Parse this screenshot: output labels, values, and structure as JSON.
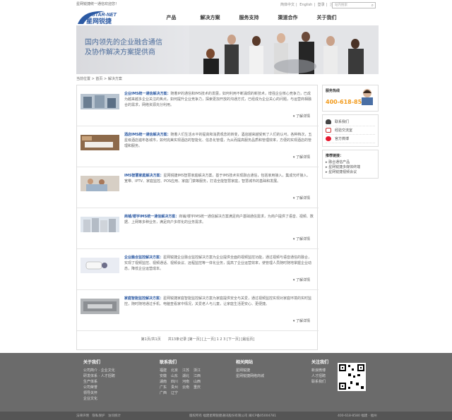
{
  "topbar": {
    "welcome": "星网锐捷统一通信欢迎您！",
    "links": [
      "简体中文",
      "|",
      "English",
      "|",
      "登录",
      "|",
      "注册",
      "|",
      "留言"
    ],
    "search_placeholder": "站内搜索"
  },
  "logo": {
    "en": "STAR-NET",
    "cn": "星网锐捷"
  },
  "nav": [
    "产品",
    "解决方案",
    "服务支持",
    "渠道合作",
    "关于我们"
  ],
  "banner": {
    "line1": "国内领先的企业融合通信",
    "line2": "及协作解决方案提供商"
  },
  "breadcrumb": {
    "prefix": "当前位置",
    "sep": ">",
    "home": "首页",
    "current": "解决方案"
  },
  "items": [
    {
      "title": "企业IMS统一通信解决方案：",
      "desc": "随着IP的通信和IMS技术的发展，如何利用不断涌现的新技术，增强企业核心竞争力，已成为越来越多企业关注的焦点，如何提升企业竞争力，探索更加开放的沟通方式，已经成为企业关心的问题，与运营商相融合的需求，网络资源充分利用。",
      "more": "了解详情"
    },
    {
      "title": "酒店IMS统一通信解决方案：",
      "desc": "随着人们生活水平的提高和消费观念的转变，酒店越来越受到了人们的认可，各种档次，五星级酒店遍布各城市，如何完美实现酒店的智能化、信息化管理，为从而提高服务品质和管理效率，方便的实现酒店的管理和服务。",
      "more": "了解详情"
    },
    {
      "title": "IMS智慧家庭解决方案：",
      "desc": "星网锐捷IMS智慧家庭解决方案，基于IMS技术实现融合通信，包括家用接入，集成光纤接入、宽带、IPTV、家庭监控、POS应用、家庭门禁等服务，打造全能智慧家庭，智慧城市的基础和发展。",
      "more": "了解详情"
    },
    {
      "title": "商铺/楼宇IMS统一通信解决方案：",
      "desc": "商铺/楼宇IMS统一通信解决方案满足商户基础通信需求，为商户提供了语音、视频、数据、上网等多种业务，满足商户多样化的业务需求。",
      "more": "了解详情"
    },
    {
      "title": "企业融合监控解决方案：",
      "desc": "星网锐捷企业融合监控解决方案为企业提供全面的视频监控功能，通过视频与语音通信的融合，实现了视频监控、视频通话、视频会议、远程监控等一体化业务，提高了企业运营效率，使管理人员随时随地掌握企业动态，降低企业运营成本。",
      "more": "了解详情"
    },
    {
      "title": "家庭智能监控解决方案：",
      "desc": "星网锐捷家庭智能监控解决方案为家庭提供安全与关爱，通过视频监控实现对家庭环境的实时监控，随时随地通过手机、电脑查看家中情况，关爱老人与儿童，让家庭生活更安心、更便捷。",
      "more": "了解详情"
    }
  ],
  "pager": "第1页/共1页　　共13条记录 [第一页] [上一页] 1 2 3 [下一页] [最后页]",
  "sidebar": {
    "hotline_label": "服务热线",
    "hotline_number": "400-618-8580",
    "menu": [
      "联系我们",
      "经验交流室",
      "官方微博"
    ],
    "links_title": "推荐链接：",
    "links": [
      "融合通信产品",
      "星网锐捷多媒体终端",
      "星网锐捷视频会议"
    ]
  },
  "footer": {
    "col1": {
      "title": "关于我们",
      "items": [
        "公司简介 · 企业文化",
        "研发体系 · 人才招聘",
        "生产体系",
        "公司荣誉",
        "领导关怀",
        "企业文化"
      ]
    },
    "col2": {
      "title": "联系我们",
      "items": [
        "福建",
        "北京",
        "江苏",
        "浙江",
        "安徽",
        "山东",
        "湖北",
        "江西",
        "湖南",
        "四川",
        "河南",
        "山西",
        "广东",
        "贵州",
        "云南",
        "重庆",
        "广西",
        "辽宁"
      ]
    },
    "col3": {
      "title": "相关网站",
      "items": [
        "星网锐捷",
        "星网锐捷网络商城"
      ]
    },
    "col4": {
      "title": "关注我们",
      "items": [
        "新浪微博",
        "人才招聘",
        "联系我们"
      ]
    },
    "bottom_left": "法律声明　隐私保护　访问统计",
    "bottom_center": "版权所有 福建星网锐捷通讯股份有限公司 闽ICP备05004781",
    "bottom_right": "400-618-8580 福建 · 福州"
  },
  "colors": {
    "accent": "#2b59a3",
    "hotline": "#f29b1d",
    "footer": "#6b6b6b"
  }
}
